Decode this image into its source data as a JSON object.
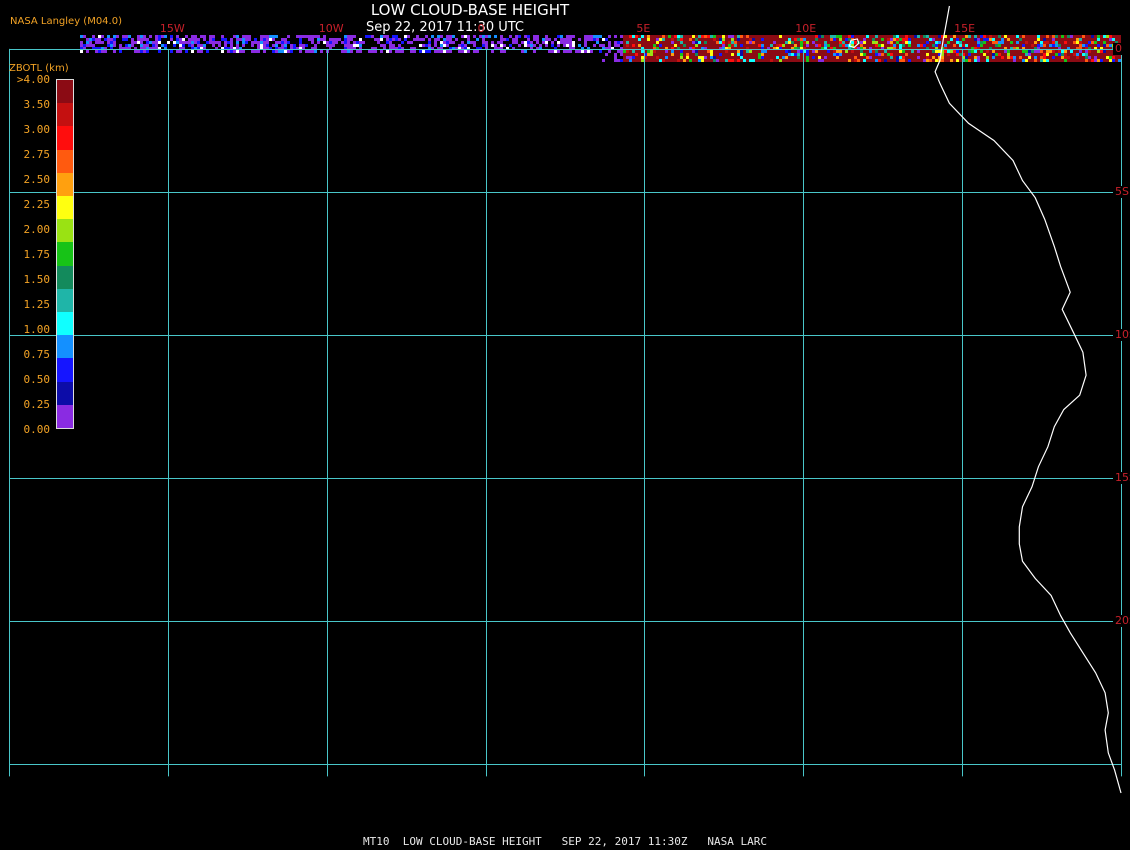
{
  "header": {
    "title": "LOW CLOUD-BASE HEIGHT",
    "subtitle": "Sep 22, 2017 11:30 UTC",
    "source": "NASA Langley (M04.0)"
  },
  "legend": {
    "title": "ZBOTL (km)",
    "ticks": [
      ">4.00",
      "3.50",
      "3.00",
      "2.75",
      "2.50",
      "2.25",
      "2.00",
      "1.75",
      "1.50",
      "1.25",
      "1.00",
      "0.75",
      "0.50",
      "0.25",
      "0.00"
    ],
    "colors": [
      "#8b0b14",
      "#c41010",
      "#ff0d0d",
      "#ff5a0f",
      "#ffa00f",
      "#ffff10",
      "#9ae213",
      "#17c317",
      "#138a5c",
      "#1fb5a8",
      "#10ffff",
      "#1490ff",
      "#1515ff",
      "#0c0ca8",
      "#8a2be2"
    ]
  },
  "map": {
    "lon_labels": [
      "15W",
      "10W",
      "0",
      "5E",
      "10E",
      "15E"
    ],
    "lat_labels": [
      "0",
      "5S",
      "10S",
      "15S",
      "20S"
    ],
    "lon_range": [
      -20,
      15
    ],
    "lat_range": [
      1.5,
      -26
    ],
    "grid_lons": [
      -20,
      -15,
      -10,
      -5,
      0,
      5,
      10,
      15
    ],
    "grid_lats": [
      0,
      -5,
      -10,
      -15,
      -20,
      -25
    ],
    "colors": {
      "grid": "#49c6c9",
      "labels": "#c8202a",
      "coastline": "#ffffff"
    },
    "coastline": [
      [
        9.6,
        1.5
      ],
      [
        9.5,
        0.9
      ],
      [
        9.4,
        0.3
      ],
      [
        9.3,
        -0.4
      ],
      [
        9.15,
        -0.8
      ],
      [
        9.3,
        -1.2
      ],
      [
        9.6,
        -1.9
      ],
      [
        10.2,
        -2.6
      ],
      [
        11.0,
        -3.2
      ],
      [
        11.6,
        -3.9
      ],
      [
        11.9,
        -4.6
      ],
      [
        12.3,
        -5.2
      ],
      [
        12.6,
        -5.95
      ],
      [
        12.9,
        -6.9
      ],
      [
        13.1,
        -7.6
      ],
      [
        13.4,
        -8.5
      ],
      [
        13.15,
        -9.1
      ],
      [
        13.5,
        -9.9
      ],
      [
        13.8,
        -10.6
      ],
      [
        13.9,
        -11.4
      ],
      [
        13.7,
        -12.1
      ],
      [
        13.2,
        -12.6
      ],
      [
        12.9,
        -13.2
      ],
      [
        12.7,
        -13.9
      ],
      [
        12.4,
        -14.6
      ],
      [
        12.2,
        -15.3
      ],
      [
        11.9,
        -16.0
      ],
      [
        11.8,
        -16.7
      ],
      [
        11.8,
        -17.3
      ],
      [
        11.9,
        -17.9
      ],
      [
        12.3,
        -18.5
      ],
      [
        12.8,
        -19.1
      ],
      [
        13.1,
        -19.8
      ],
      [
        13.4,
        -20.4
      ],
      [
        13.8,
        -21.1
      ],
      [
        14.2,
        -21.8
      ],
      [
        14.5,
        -22.5
      ],
      [
        14.6,
        -23.2
      ],
      [
        14.5,
        -23.8
      ],
      [
        14.6,
        -24.6
      ],
      [
        14.8,
        -25.2
      ],
      [
        15.0,
        -26.0
      ]
    ],
    "island": [
      [
        6.5,
        0.3
      ],
      [
        6.7,
        0.35
      ],
      [
        6.75,
        0.2
      ],
      [
        6.6,
        0.05
      ],
      [
        6.45,
        0.1
      ],
      [
        6.5,
        0.3
      ]
    ]
  },
  "footer": {
    "text": "MT10  LOW CLOUD-BASE HEIGHT   SEP 22, 2017 11:30Z   NASA LARC"
  }
}
